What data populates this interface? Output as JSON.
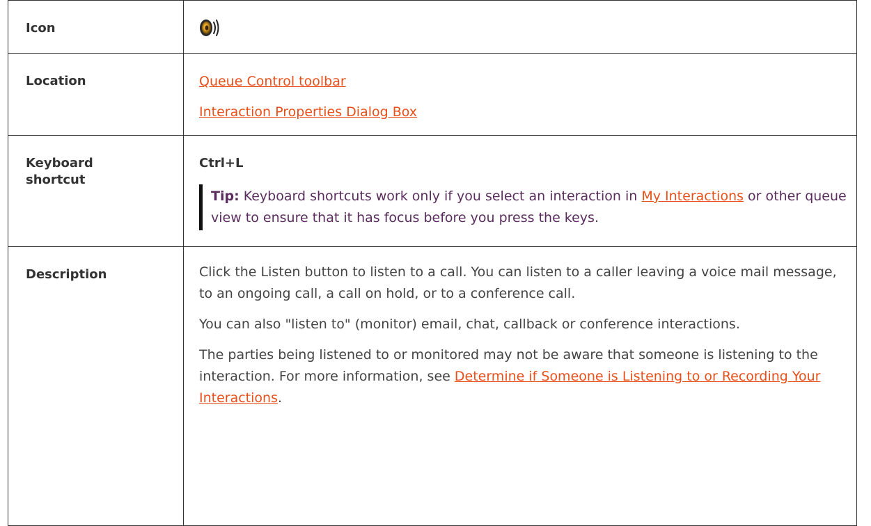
{
  "rows": {
    "icon": {
      "label": "Icon",
      "icon_name": "speaker-icon"
    },
    "location": {
      "label": "Location",
      "links": [
        "Queue Control toolbar",
        "Interaction Properties Dialog Box"
      ]
    },
    "shortcut": {
      "label": "Keyboard shortcut",
      "keys": "Ctrl+L",
      "tip_label": "Tip:",
      "tip_text_before": " Keyboard shortcuts work only if you select an interaction in ",
      "tip_link": "My Interactions",
      "tip_text_after": " or other queue view to ensure that it has focus before you press the keys."
    },
    "description": {
      "label": "Description",
      "paragraph1": "Click the Listen button to listen to a call. You can listen to a caller leaving a voice mail message, to an ongoing call, a call on hold, or to a conference call.",
      "paragraph2": "You can also \"listen to\" (monitor) email, chat, callback or conference interactions.",
      "paragraph3_before": "The parties being listened to or monitored may not be aware that someone is listening to the interaction. For more information, see ",
      "paragraph3_link": "Determine if Someone is Listening to or Recording Your Interactions",
      "paragraph3_after": "."
    }
  },
  "colors": {
    "link": "#e8501b",
    "tip_text": "#5a2d5e",
    "border": "#333333"
  }
}
